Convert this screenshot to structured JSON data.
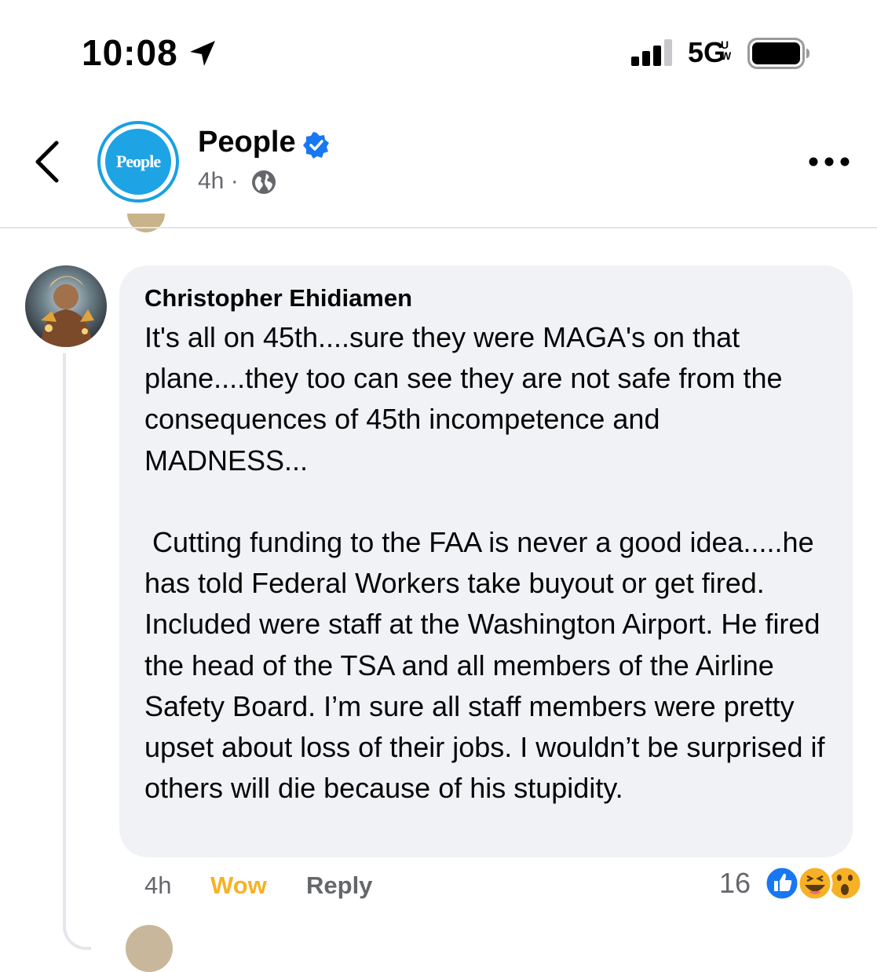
{
  "status_bar": {
    "time": "10:08",
    "network": "5G",
    "network_sup_top": "U",
    "network_sup_bottom": "W"
  },
  "post_header": {
    "page_name": "People",
    "avatar_text": "People",
    "time_ago": "4h ·",
    "accent_color": "#1aa0e3",
    "verified_color": "#1877f2"
  },
  "comment": {
    "author": "Christopher Ehidiamen",
    "text": "It's all on 45th....sure they were MAGA's on that plane....they too can see they are not safe from the consequences of 45th incompetence and MADNESS...\n\n Cutting funding to the FAA is never a good idea.....he has told Federal Workers take buyout or get fired. Included were staff at the Washington Airport. He fired the head of the TSA and all members of the Airline Safety Board. I’m sure all staff members were pretty upset about loss of their jobs. I wouldn’t be surprised if others will die because of his stupidity.",
    "time_ago": "4h",
    "reaction_label": "Wow",
    "reply_label": "Reply",
    "reaction_count": "16",
    "wow_color": "#f7b125"
  }
}
